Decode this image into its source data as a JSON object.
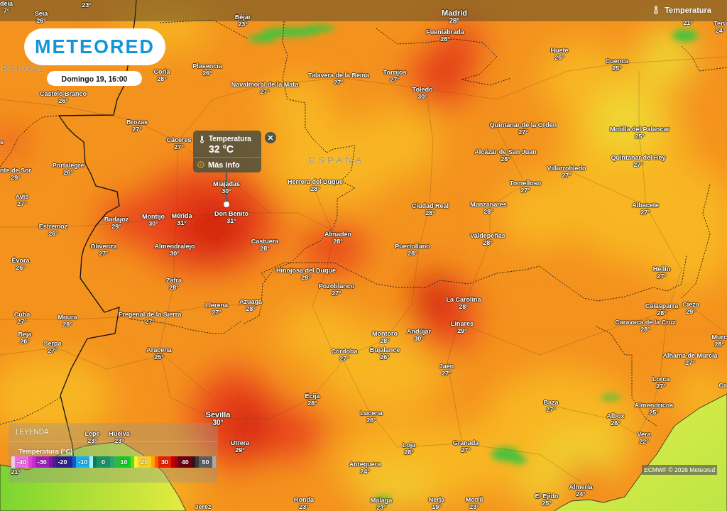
{
  "top_bar": {
    "layer_button": "Temperatura"
  },
  "logo": "METEORED",
  "timestamp": "Domingo 19, 16:00",
  "country_labels": [
    "RTUGAL",
    "ESPAÑA"
  ],
  "cities": [
    {
      "kind": "city",
      "name": "deia",
      "temp": "7°"
    },
    {
      "kind": "city",
      "temp": "23°"
    },
    {
      "kind": "city",
      "name": "Seia",
      "temp": "26°"
    },
    {
      "kind": "city",
      "name": "Béjar",
      "temp": "23°"
    },
    {
      "kind": "capital",
      "name": "Madrid",
      "temp": "28°"
    },
    {
      "kind": "city",
      "temp": "21°"
    },
    {
      "kind": "city",
      "name": "Teru",
      "temp": "24°"
    },
    {
      "kind": "city",
      "name": "Fuenlabrada",
      "temp": "28°"
    },
    {
      "kind": "city",
      "name": "Huete",
      "temp": "26°"
    },
    {
      "kind": "city",
      "name": "Cuenca",
      "temp": "25°"
    },
    {
      "kind": "city",
      "name": "Plasencia",
      "temp": "26°"
    },
    {
      "kind": "city",
      "name": "Coria",
      "temp": "28°"
    },
    {
      "kind": "city",
      "name": "Talavera de la Reina",
      "temp": "27°"
    },
    {
      "kind": "city",
      "name": "Torrijos",
      "temp": "27°"
    },
    {
      "kind": "city",
      "name": "Navalmoral de la Mata",
      "temp": "27°"
    },
    {
      "kind": "city",
      "name": "Toledo",
      "temp": "30°"
    },
    {
      "kind": "city",
      "name": "Castelo Branco",
      "temp": "26°"
    },
    {
      "kind": "city",
      "name": "Brozas",
      "temp": "27°"
    },
    {
      "kind": "city",
      "name": "Quintanar de la Orden",
      "temp": "27°"
    },
    {
      "kind": "city",
      "name": "Motilla del Palancar",
      "temp": "25°"
    },
    {
      "kind": "city",
      "name": "s"
    },
    {
      "kind": "city",
      "name": "Cáceres",
      "temp": "27°"
    },
    {
      "kind": "city",
      "name": "Alcázar de San Juan",
      "temp": "28°"
    },
    {
      "kind": "city",
      "name": "Quintanar del Rey",
      "temp": "27°"
    },
    {
      "kind": "city",
      "name": "nte de Sor",
      "temp": "29°"
    },
    {
      "kind": "city",
      "name": "Portalegre",
      "temp": "26°"
    },
    {
      "kind": "city",
      "name": "Villarrobledo",
      "temp": "27°"
    },
    {
      "kind": "city",
      "name": "Miajadas",
      "temp": "30°"
    },
    {
      "kind": "city",
      "name": "Herrera del Duque",
      "temp": "28°"
    },
    {
      "kind": "city",
      "name": "Tomelloso",
      "temp": "27°"
    },
    {
      "kind": "city",
      "name": "Avis",
      "temp": "27°"
    },
    {
      "kind": "city",
      "name": "Ciudad Real",
      "temp": "28°"
    },
    {
      "kind": "city",
      "name": "Manzanares",
      "temp": "28°"
    },
    {
      "kind": "city",
      "name": "Albacete",
      "temp": "27°"
    },
    {
      "kind": "city",
      "name": "Badajoz",
      "temp": "29°"
    },
    {
      "kind": "city",
      "name": "Montijo",
      "temp": "30°"
    },
    {
      "kind": "city",
      "name": "Mérida",
      "temp": "31°"
    },
    {
      "kind": "city",
      "name": "Don Benito",
      "temp": "31°"
    },
    {
      "kind": "city",
      "name": "Estremoz",
      "temp": "26°"
    },
    {
      "kind": "city",
      "name": "Almadén",
      "temp": "28°"
    },
    {
      "kind": "city",
      "name": "Valdepeñas",
      "temp": "28°"
    },
    {
      "kind": "city",
      "name": "Olivenza",
      "temp": "27°"
    },
    {
      "kind": "city",
      "name": "Almendralejo",
      "temp": "30°"
    },
    {
      "kind": "city",
      "name": "Castuera",
      "temp": "28°"
    },
    {
      "kind": "city",
      "name": "Puertollano",
      "temp": "28°"
    },
    {
      "kind": "city",
      "name": "Évora",
      "temp": "26°"
    },
    {
      "kind": "city",
      "name": "Hinojosa del Duque",
      "temp": "29°"
    },
    {
      "kind": "city",
      "name": "Hellín",
      "temp": "27°"
    },
    {
      "kind": "city",
      "name": "Zafra",
      "temp": "28°"
    },
    {
      "kind": "city",
      "name": "Pozoblanco",
      "temp": "27°"
    },
    {
      "kind": "city",
      "name": "Llerena",
      "temp": "27°"
    },
    {
      "kind": "city",
      "name": "Azuaga",
      "temp": "28°"
    },
    {
      "kind": "city",
      "name": "La Carolina",
      "temp": "28°"
    },
    {
      "kind": "city",
      "name": "Calasparra",
      "temp": "28°"
    },
    {
      "kind": "city",
      "name": "Cieza",
      "temp": "29°"
    },
    {
      "kind": "city",
      "name": "Cuba",
      "temp": "27°"
    },
    {
      "kind": "city",
      "name": "Moura",
      "temp": "28°"
    },
    {
      "kind": "city",
      "name": "Fregenal de la Sierra",
      "temp": "27°"
    },
    {
      "kind": "city",
      "name": "Linares",
      "temp": "29°"
    },
    {
      "kind": "city",
      "name": "Caravaca de la Cruz",
      "temp": "28°"
    },
    {
      "kind": "city",
      "name": "Beja",
      "temp": "26°"
    },
    {
      "kind": "city",
      "name": "Montoro",
      "temp": "28°"
    },
    {
      "kind": "city",
      "name": "Andújar",
      "temp": "30°"
    },
    {
      "kind": "city",
      "name": "Murc",
      "temp": "28°"
    },
    {
      "kind": "city",
      "name": "Serpa",
      "temp": "27°"
    },
    {
      "kind": "city",
      "name": "Aracena",
      "temp": "25°"
    },
    {
      "kind": "city",
      "name": "Córdoba",
      "temp": "27°"
    },
    {
      "kind": "city",
      "name": "Bujalance",
      "temp": "26°"
    },
    {
      "kind": "city",
      "name": "Alhama de Murcia",
      "temp": "27°"
    },
    {
      "kind": "city",
      "name": "Jaén",
      "temp": "27°"
    },
    {
      "kind": "city",
      "name": "Lorca",
      "temp": "27°"
    },
    {
      "kind": "city",
      "name": "Ca"
    },
    {
      "kind": "city",
      "name": "Écija",
      "temp": "28°"
    },
    {
      "kind": "city",
      "name": "Baza",
      "temp": "27°"
    },
    {
      "kind": "city",
      "name": "Almendricos",
      "temp": "25°"
    },
    {
      "kind": "capital",
      "name": "Sevilla",
      "temp": "30°"
    },
    {
      "kind": "city",
      "name": "Lucena",
      "temp": "26°"
    },
    {
      "kind": "city",
      "name": "Albox",
      "temp": "26°"
    },
    {
      "kind": "city",
      "name": "Lepe",
      "temp": "23°"
    },
    {
      "kind": "city",
      "name": "Huelva",
      "temp": "23°"
    },
    {
      "kind": "city",
      "name": "Vera",
      "temp": "22°"
    },
    {
      "kind": "city",
      "name": "Utrera",
      "temp": "29°"
    },
    {
      "kind": "city",
      "name": "Loja",
      "temp": "28°"
    },
    {
      "kind": "city",
      "name": "Granada",
      "temp": "27°"
    },
    {
      "kind": "city",
      "temp": "21°"
    },
    {
      "kind": "city",
      "name": "Antequera",
      "temp": "24°"
    },
    {
      "kind": "city",
      "name": "Almería",
      "temp": "24°"
    },
    {
      "kind": "city",
      "name": "Jerez"
    },
    {
      "kind": "city",
      "name": "Ronda",
      "temp": "23°"
    },
    {
      "kind": "city",
      "name": "Málaga",
      "temp": "23°"
    },
    {
      "kind": "city",
      "name": "Nerja",
      "temp": "19°"
    },
    {
      "kind": "city",
      "name": "Motril",
      "temp": "23°"
    },
    {
      "kind": "city",
      "name": "El Ejido",
      "temp": "25°"
    }
  ],
  "popup": {
    "title": "Temperatura",
    "value": "32 °C",
    "link": "Más info"
  },
  "legend": {
    "title": "LEYENDA",
    "variable": "Temperatura (°C)",
    "scale": [
      "-40",
      "-30",
      "-20",
      "-10",
      "0",
      "10",
      "20",
      "30",
      "40",
      "50"
    ]
  },
  "attribution": "ECMWF © 2026 Meteored"
}
